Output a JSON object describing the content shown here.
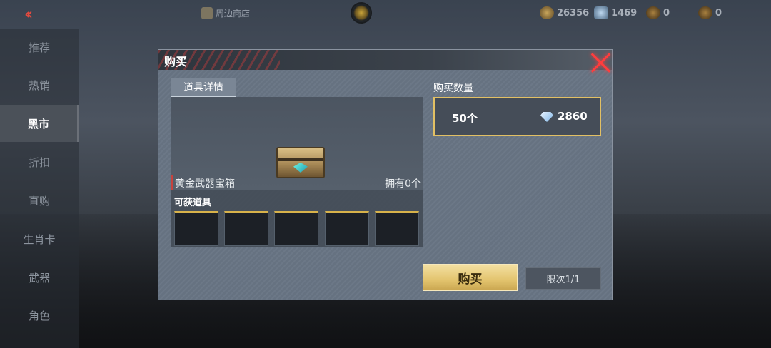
{
  "topbar": {
    "shop_label": "周边商店",
    "currencies": [
      {
        "icon": "gold-coin-icon",
        "value": "26356"
      },
      {
        "icon": "diamond-icon",
        "value": "1469"
      },
      {
        "icon": "badge-icon",
        "value": "0"
      },
      {
        "icon": "badge-icon",
        "value": "0"
      }
    ]
  },
  "sidebar": {
    "items": [
      {
        "label": "推荐",
        "active": false
      },
      {
        "label": "热销",
        "active": false
      },
      {
        "label": "黑市",
        "active": true
      },
      {
        "label": "折扣",
        "active": false
      },
      {
        "label": "直购",
        "active": false
      },
      {
        "label": "生肖卡",
        "active": false
      },
      {
        "label": "武器",
        "active": false
      },
      {
        "label": "角色",
        "active": false
      }
    ]
  },
  "modal": {
    "title": "购买",
    "tab_label": "道具详情",
    "item_name": "黄金武器宝箱",
    "owned": "拥有0个",
    "obtain_label": "可获道具",
    "qty_label": "购买数量",
    "qty_value": "50个",
    "price": "2860",
    "buy_label": "购买",
    "limit_label": "限次1/1"
  },
  "colors": {
    "accent_gold": "#e2c064",
    "close_red": "#ff3d3d"
  }
}
